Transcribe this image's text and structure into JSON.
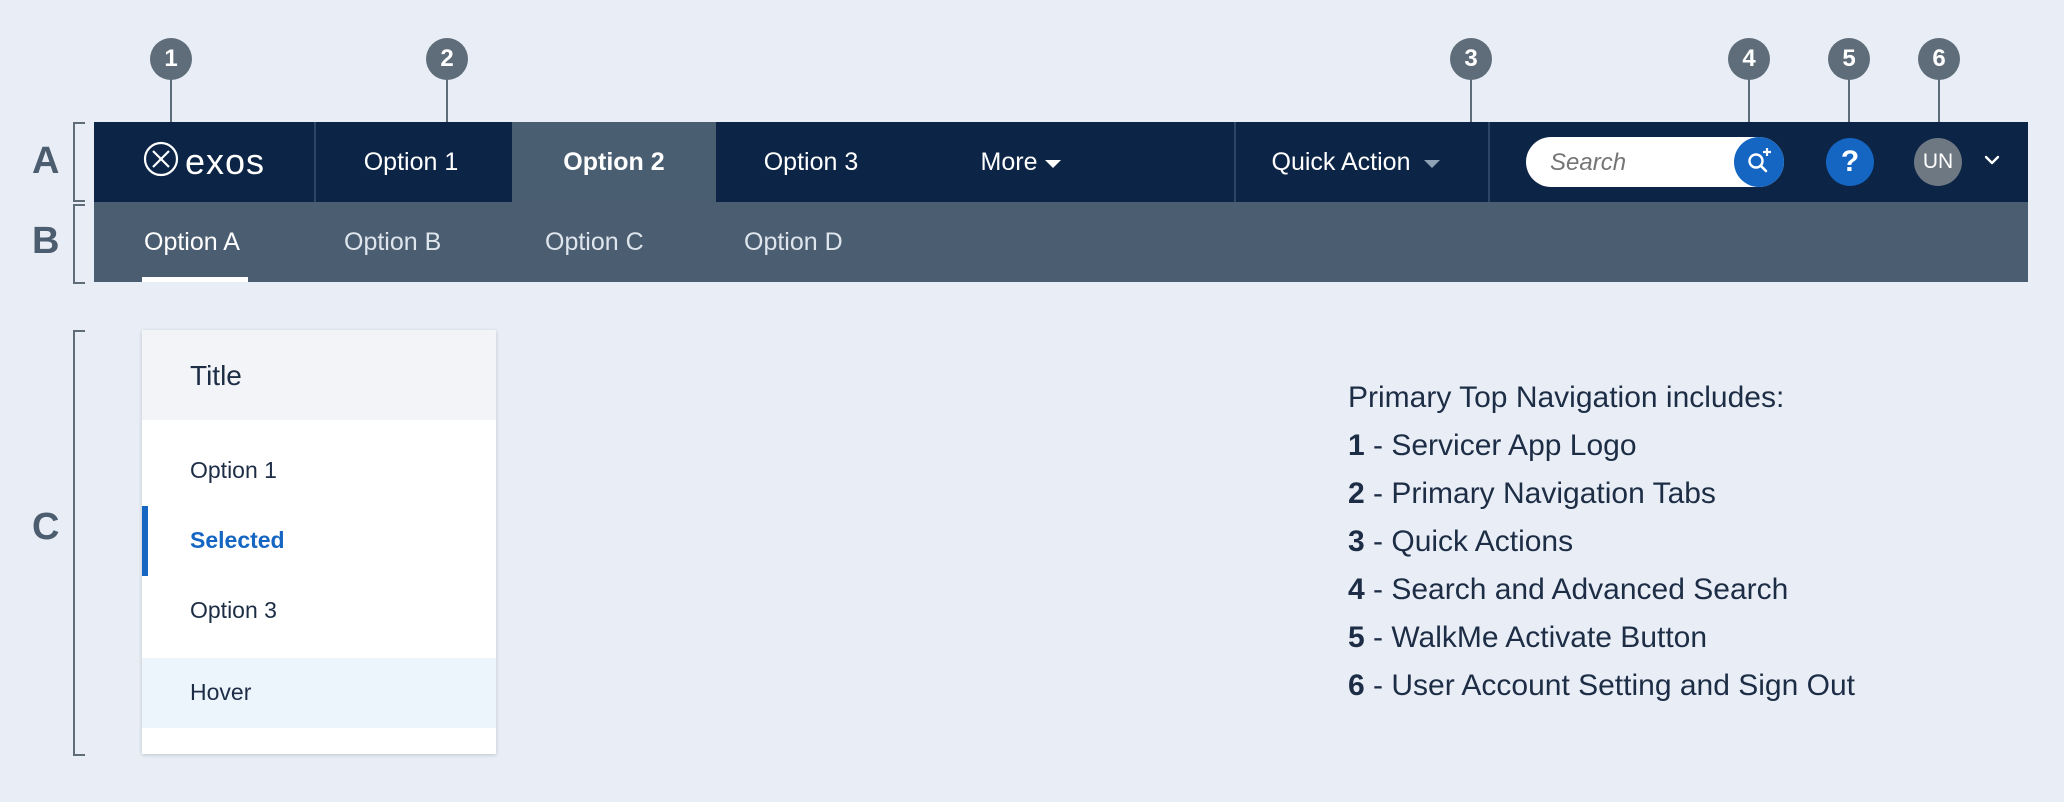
{
  "markers": [
    "1",
    "2",
    "3",
    "4",
    "5",
    "6"
  ],
  "row_letters": [
    "A",
    "B",
    "C"
  ],
  "nav_primary": {
    "logo_text": "exos",
    "tabs": [
      "Option 1",
      "Option 2",
      "Option 3"
    ],
    "active_tab": "Option 2",
    "more_label": "More",
    "quick_action_label": "Quick Action",
    "search_placeholder": "Search",
    "help_label": "?",
    "avatar_initials": "UN"
  },
  "nav_secondary": {
    "tabs": [
      "Option A",
      "Option B",
      "Option C",
      "Option D"
    ],
    "active_tab": "Option A"
  },
  "menu_card": {
    "title": "Title",
    "items": [
      "Option 1",
      "Selected",
      "Option 3",
      "Hover"
    ],
    "selected_item": "Selected",
    "hover_item": "Hover"
  },
  "legend": {
    "heading": "Primary Top Navigation includes:",
    "items": [
      {
        "num": "1",
        "text": "- Servicer App Logo"
      },
      {
        "num": "2",
        "text": "- Primary Navigation Tabs"
      },
      {
        "num": "3",
        "text": "- Quick Actions"
      },
      {
        "num": "4",
        "text": "- Search and Advanced Search"
      },
      {
        "num": "5",
        "text": "- WalkMe Activate Button"
      },
      {
        "num": "6",
        "text": "- User Account Setting and Sign Out"
      }
    ]
  },
  "colors": {
    "background": "#e9eef6",
    "nav_primary": "#0c2445",
    "nav_active_tab": "#4a5e72",
    "nav_secondary": "#4a5d71",
    "accent_blue": "#1566c2",
    "marker": "#5f6d7a"
  }
}
